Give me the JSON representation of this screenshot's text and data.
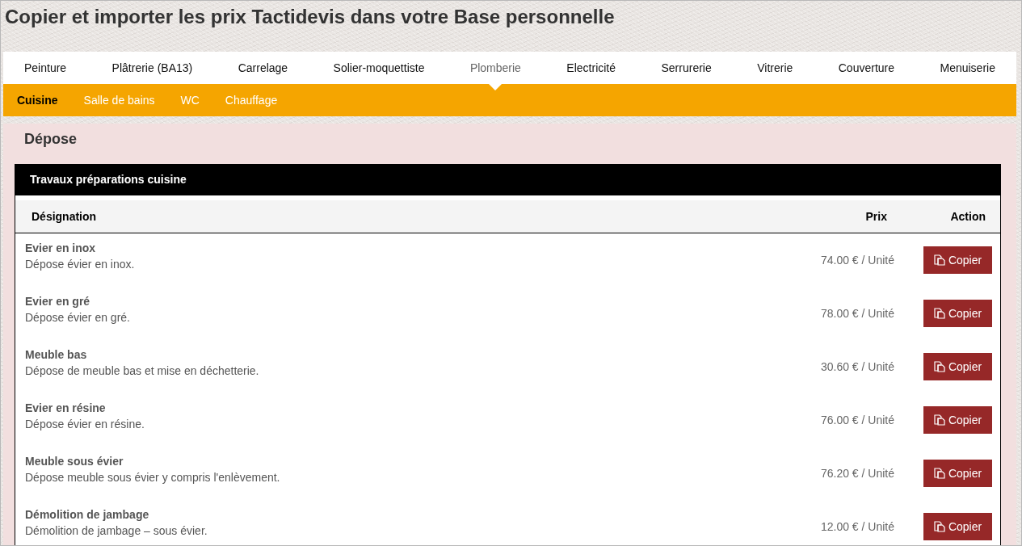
{
  "title": "Copier et importer les prix Tactidevis dans votre Base personnelle",
  "category_tabs": [
    {
      "label": "Peinture",
      "selected": false
    },
    {
      "label": "Plâtrerie (BA13)",
      "selected": false
    },
    {
      "label": "Carrelage",
      "selected": false
    },
    {
      "label": "Solier-moquettiste",
      "selected": false
    },
    {
      "label": "Plomberie",
      "selected": true
    },
    {
      "label": "Electricité",
      "selected": false
    },
    {
      "label": "Serrurerie",
      "selected": false
    },
    {
      "label": "Vitrerie",
      "selected": false
    },
    {
      "label": "Couverture",
      "selected": false
    },
    {
      "label": "Menuiserie",
      "selected": false
    }
  ],
  "subcategory_tabs": [
    {
      "label": "Cuisine",
      "selected": true
    },
    {
      "label": "Salle de bains",
      "selected": false
    },
    {
      "label": "WC",
      "selected": false
    },
    {
      "label": "Chauffage",
      "selected": false
    }
  ],
  "section": {
    "heading": "Dépose",
    "table": {
      "title": "Travaux préparations cuisine",
      "columns": [
        "Désignation",
        "Prix",
        "Action"
      ],
      "rows": [
        {
          "name": "Evier en inox",
          "description": "Dépose évier en inox.",
          "price": "74.00 € / Unité",
          "action": "Copier"
        },
        {
          "name": "Evier en gré",
          "description": "Dépose évier en gré.",
          "price": "78.00 € / Unité",
          "action": "Copier"
        },
        {
          "name": "Meuble bas",
          "description": "Dépose de meuble bas et mise en déchetterie.",
          "price": "30.60 € / Unité",
          "action": "Copier"
        },
        {
          "name": "Evier en résine",
          "description": "Dépose évier en résine.",
          "price": "76.00 € / Unité",
          "action": "Copier"
        },
        {
          "name": "Meuble sous évier",
          "description": "Dépose meuble sous évier y compris l'enlèvement.",
          "price": "76.20 € / Unité",
          "action": "Copier"
        },
        {
          "name": "Démolition de jambage",
          "description": "Démolition de jambage – sous évier.",
          "price": "12.00 € / Unité",
          "action": "Copier"
        }
      ]
    }
  }
}
